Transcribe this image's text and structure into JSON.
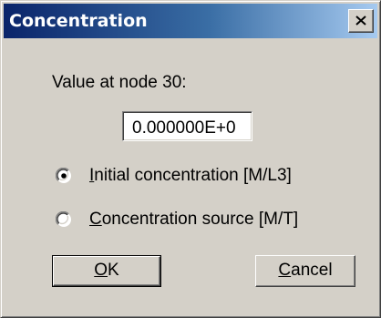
{
  "dialog": {
    "title": "Concentration",
    "close_icon": "close-icon",
    "value_label": "Value at node 30:",
    "value": "0.000000E+0"
  },
  "options": [
    {
      "label_mnemonic": "I",
      "label_rest": "nitial concentration [M/L3]",
      "selected": true
    },
    {
      "label_mnemonic": "C",
      "label_rest": "oncentration source [M/T]",
      "selected": false
    }
  ],
  "buttons": {
    "ok_mnemonic": "O",
    "ok_rest": "K",
    "cancel_mnemonic": "C",
    "cancel_rest": "ancel"
  },
  "colors": {
    "title_gradient_start": "#0a246a",
    "title_gradient_end": "#a6caf0",
    "face": "#d4d0c8"
  }
}
